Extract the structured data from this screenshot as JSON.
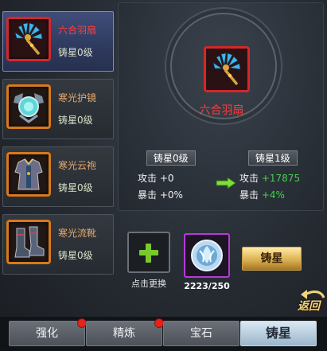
{
  "items": [
    {
      "name": "六合羽扇",
      "level": "铸星0级",
      "icon": "feather-fan-icon",
      "selected": true
    },
    {
      "name": "寒光护镜",
      "level": "铸星0级",
      "icon": "chest-mirror-icon",
      "selected": false
    },
    {
      "name": "寒光云袍",
      "level": "铸星0级",
      "icon": "robe-icon",
      "selected": false
    },
    {
      "name": "寒光流靴",
      "level": "铸星0级",
      "icon": "boots-icon",
      "selected": false
    }
  ],
  "detail": {
    "name": "六合羽扇",
    "current_level": "铸星0级",
    "next_level": "铸星1级",
    "current_stats": {
      "attack": "攻击 +0",
      "crit": "暴击 +0%"
    },
    "next_stats": {
      "attack_label": "攻击",
      "attack_bonus": "+17875",
      "crit_label": "暴击",
      "crit_bonus": "+4%"
    }
  },
  "actions": {
    "replace_label": "点击更换",
    "gem_count": "2223/250",
    "forge_label": "铸星",
    "back_label": "返回"
  },
  "tabs": [
    {
      "label": "强化",
      "badge": true,
      "active": false
    },
    {
      "label": "精炼",
      "badge": true,
      "active": false
    },
    {
      "label": "宝石",
      "badge": false,
      "active": false
    },
    {
      "label": "铸星",
      "badge": false,
      "active": true
    }
  ],
  "colors": {
    "selected_name": "#ff4040",
    "item_name": "#e8a86b",
    "bonus_green": "#45d04b",
    "rare_border": "#d3282b",
    "epic_border": "#b33bd8"
  }
}
